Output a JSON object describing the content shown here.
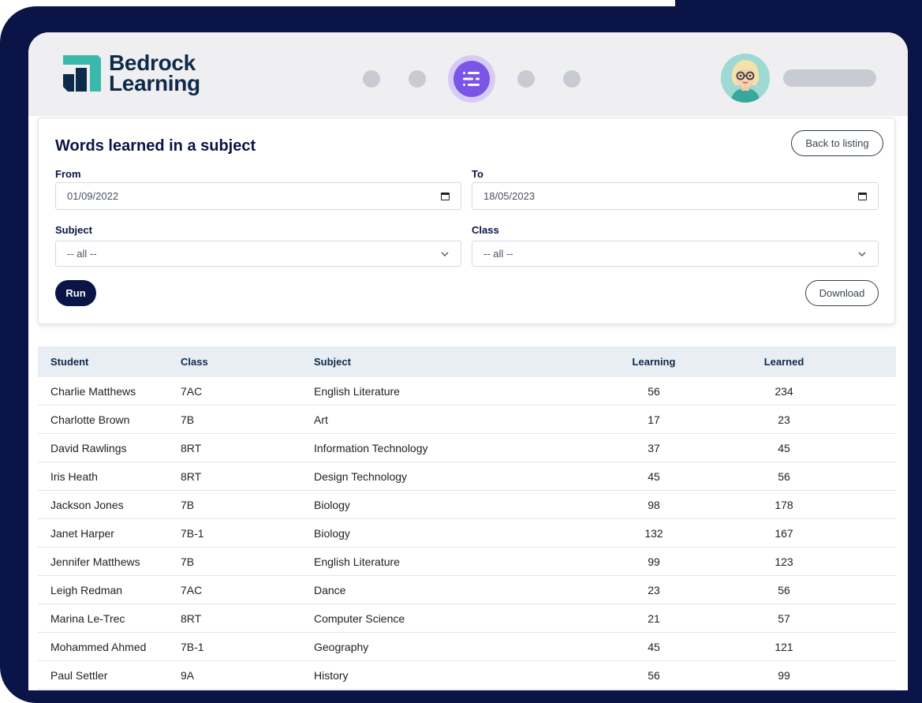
{
  "brand": {
    "line1": "Bedrock",
    "line2": "Learning"
  },
  "colors": {
    "frame": "#0b1446",
    "primary": "#0b1446",
    "accent": "#7a55e8",
    "logo_teal": "#3ab8ac",
    "header_bg": "#efeff1"
  },
  "nav": {
    "icons": [
      "nav-dot",
      "nav-dot",
      "reports-menu-icon",
      "nav-dot",
      "nav-dot"
    ]
  },
  "report": {
    "title": "Words learned in a subject",
    "back_label": "Back to listing",
    "from_label": "From",
    "from_value": "01/09/2022",
    "to_label": "To",
    "to_value": "18/05/2023",
    "subject_label": "Subject",
    "subject_value": "-- all --",
    "class_label": "Class",
    "class_value": "-- all --",
    "run_label": "Run",
    "download_label": "Download"
  },
  "table": {
    "headers": {
      "student": "Student",
      "class": "Class",
      "subject": "Subject",
      "learning": "Learning",
      "learned": "Learned"
    },
    "rows": [
      {
        "student": "Charlie Matthews",
        "class": "7AC",
        "subject": "English Literature",
        "learning": "56",
        "learned": "234"
      },
      {
        "student": "Charlotte Brown",
        "class": "7B",
        "subject": "Art",
        "learning": "17",
        "learned": "23"
      },
      {
        "student": "David Rawlings",
        "class": "8RT",
        "subject": "Information Technology",
        "learning": "37",
        "learned": "45"
      },
      {
        "student": "Iris Heath",
        "class": "8RT",
        "subject": "Design Technology",
        "learning": "45",
        "learned": "56"
      },
      {
        "student": "Jackson Jones",
        "class": "7B",
        "subject": "Biology",
        "learning": "98",
        "learned": "178"
      },
      {
        "student": "Janet Harper",
        "class": "7B-1",
        "subject": "Biology",
        "learning": "132",
        "learned": "167"
      },
      {
        "student": "Jennifer Matthews",
        "class": "7B",
        "subject": "English Literature",
        "learning": "99",
        "learned": "123"
      },
      {
        "student": "Leigh Redman",
        "class": "7AC",
        "subject": "Dance",
        "learning": "23",
        "learned": "56"
      },
      {
        "student": "Marina Le-Trec",
        "class": "8RT",
        "subject": "Computer Science",
        "learning": "21",
        "learned": "57"
      },
      {
        "student": "Mohammed Ahmed",
        "class": "7B-1",
        "subject": "Geography",
        "learning": "45",
        "learned": "121"
      },
      {
        "student": "Paul Settler",
        "class": "9A",
        "subject": "History",
        "learning": "56",
        "learned": "99"
      }
    ]
  }
}
